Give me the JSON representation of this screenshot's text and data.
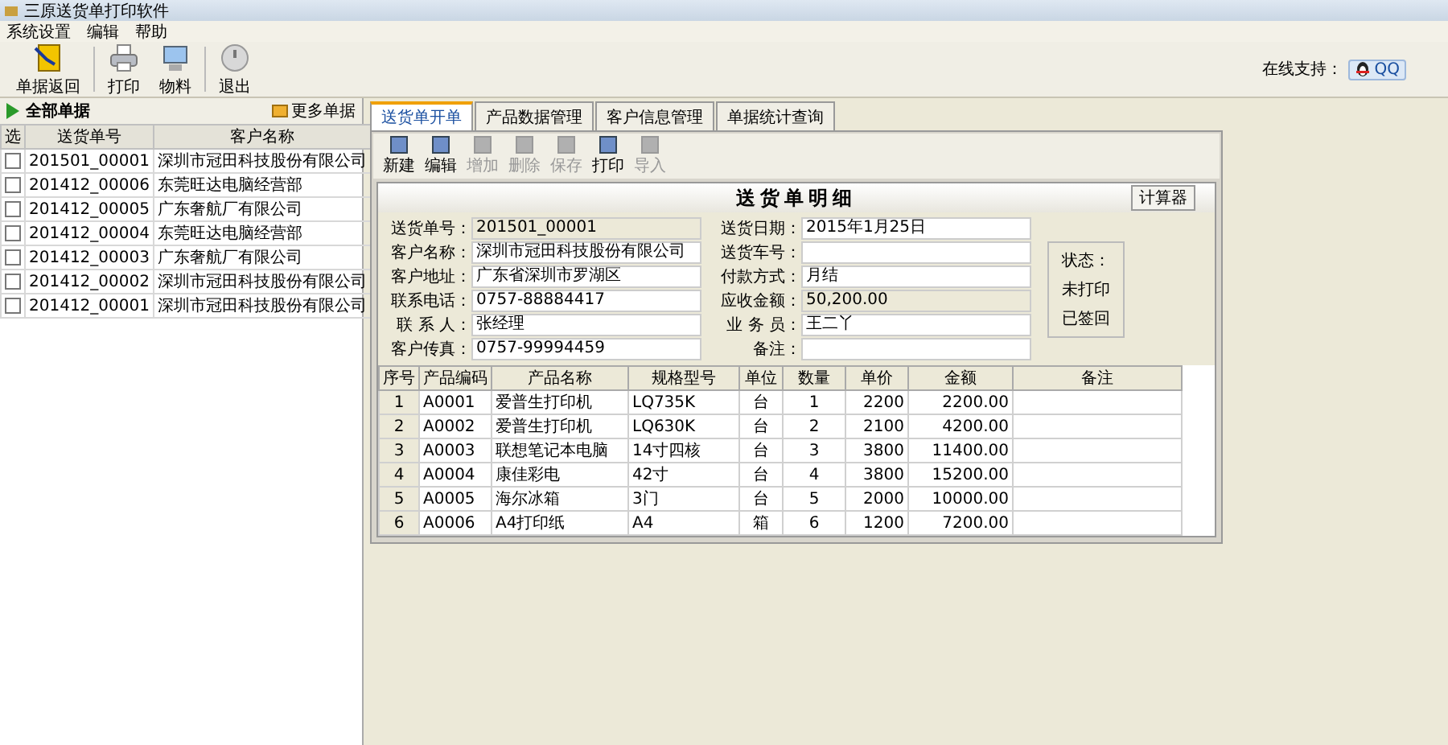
{
  "window": {
    "title": "三原送货单打印软件"
  },
  "menu": [
    "系统设置",
    "编辑",
    "帮助"
  ],
  "toolbar": [
    {
      "label": "单据返回",
      "kind": "return"
    },
    {
      "label": "打印",
      "kind": "print"
    },
    {
      "label": "物料",
      "kind": "material"
    },
    {
      "label": "退出",
      "kind": "exit"
    }
  ],
  "support": {
    "label": "在线支持：",
    "button": "QQ"
  },
  "sidebar": {
    "title": "全部单据",
    "more_button": "更多单据",
    "columns": [
      "选",
      "送货单号",
      "客户名称"
    ],
    "rows": [
      {
        "checked": false,
        "number": "201501_00001",
        "customer": "深圳市冠田科技股份有限公司"
      },
      {
        "checked": false,
        "number": "201412_00006",
        "customer": "东莞旺达电脑经营部"
      },
      {
        "checked": false,
        "number": "201412_00005",
        "customer": "广东奢航厂有限公司"
      },
      {
        "checked": false,
        "number": "201412_00004",
        "customer": "东莞旺达电脑经营部"
      },
      {
        "checked": false,
        "number": "201412_00003",
        "customer": "广东奢航厂有限公司"
      },
      {
        "checked": false,
        "number": "201412_00002",
        "customer": "深圳市冠田科技股份有限公司"
      },
      {
        "checked": false,
        "number": "201412_00001",
        "customer": "深圳市冠田科技股份有限公司"
      }
    ]
  },
  "tabs": [
    {
      "label": "送货单开单",
      "selected": true
    },
    {
      "label": "产品数据管理",
      "selected": false
    },
    {
      "label": "客户信息管理",
      "selected": false
    },
    {
      "label": "单据统计查询",
      "selected": false
    }
  ],
  "actions": [
    {
      "label": "新建",
      "disabled": false
    },
    {
      "label": "编辑",
      "disabled": false
    },
    {
      "label": "增加",
      "disabled": true
    },
    {
      "label": "删除",
      "disabled": true
    },
    {
      "label": "保存",
      "disabled": true
    },
    {
      "label": "打印",
      "disabled": false
    },
    {
      "label": "导入",
      "disabled": true
    }
  ],
  "form": {
    "title": "送货单明细",
    "calculator_button": "计算器",
    "left_fields": [
      {
        "label": "送货单号：",
        "value": "201501_00001",
        "readonly": true
      },
      {
        "label": "客户名称：",
        "value": "深圳市冠田科技股份有限公司",
        "readonly": false
      },
      {
        "label": "客户地址：",
        "value": "广东省深圳市罗湖区",
        "readonly": false
      },
      {
        "label": "联系电话：",
        "value": "0757-88884417",
        "readonly": false
      },
      {
        "label": "联 系 人：",
        "value": "张经理",
        "readonly": false
      },
      {
        "label": "客户传真：",
        "value": "0757-99994459",
        "readonly": false
      }
    ],
    "right_fields": [
      {
        "label": "送货日期：",
        "value": "2015年1月25日",
        "readonly": false
      },
      {
        "label": "送货车号：",
        "readonly": false
      },
      {
        "label": "付款方式：",
        "value": "月结",
        "readonly": false
      },
      {
        "label": "应收金额：",
        "value": "50,200.00",
        "readonly": true
      },
      {
        "label": "业 务 员：",
        "value": "王二丫",
        "readonly": false
      },
      {
        "label": "备注：",
        "readonly": false
      }
    ],
    "status": {
      "title": "状态：",
      "items": [
        "未打印",
        "已签回"
      ]
    }
  },
  "table": {
    "columns": [
      "序号",
      "产品编码",
      "产品名称",
      "规格型号",
      "单位",
      "数量",
      "单价",
      "金额",
      "备注"
    ],
    "rows": [
      [
        "1",
        "A0001",
        "爱普生打印机",
        "LQ735K",
        "台",
        "1",
        "2200",
        "2200.00"
      ],
      [
        "2",
        "A0002",
        "爱普生打印机",
        "LQ630K",
        "台",
        "2",
        "2100",
        "4200.00"
      ],
      [
        "3",
        "A0003",
        "联想笔记本电脑",
        "14寸四核",
        "台",
        "3",
        "3800",
        "11400.00"
      ],
      [
        "4",
        "A0004",
        "康佳彩电",
        "42寸",
        "台",
        "4",
        "3800",
        "15200.00"
      ],
      [
        "5",
        "A0005",
        "海尔冰箱",
        "3门",
        "台",
        "5",
        "2000",
        "10000.00"
      ],
      [
        "6",
        "A0006",
        "A4打印纸",
        "A4",
        "箱",
        "6",
        "1200",
        "7200.00"
      ]
    ]
  }
}
